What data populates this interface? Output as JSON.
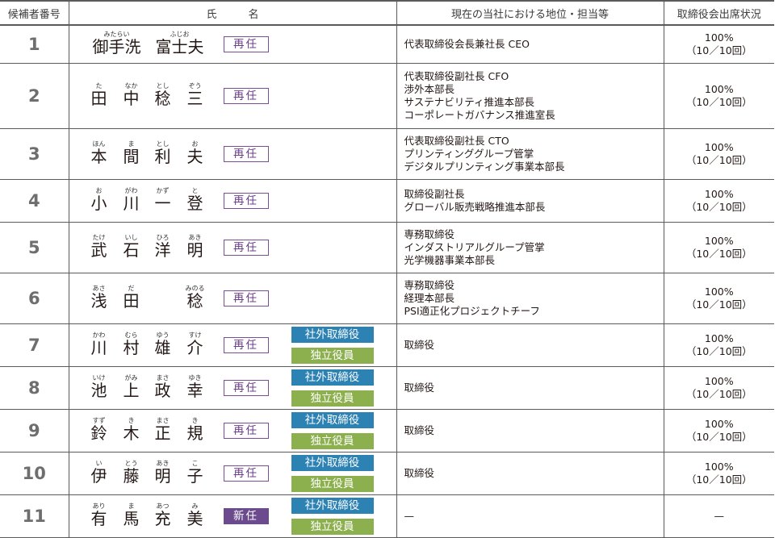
{
  "headers": {
    "number": "候補者番号",
    "name": "氏　　　名",
    "position": "現在の当社における地位・担当等",
    "attendance": "取締役会出席状況"
  },
  "colors": {
    "reappoint": "#6b3f8c",
    "new": "#6b4a8e",
    "outside": "#2d82b4",
    "independent": "#8cb04e"
  },
  "candidates": [
    {
      "no": "1",
      "chars": [
        {
          "k": "御手洗",
          "r": "みたらい"
        },
        {
          "k": "富士夫",
          "r": "ふじお"
        }
      ],
      "status": "再任",
      "outside": "",
      "independent": "",
      "position": [
        "代表取締役会長兼社長 CEO"
      ],
      "attendance": [
        "100%",
        "（10／10回）"
      ]
    },
    {
      "no": "2",
      "chars": [
        {
          "k": "田",
          "r": "た"
        },
        {
          "k": "中",
          "r": "なか"
        },
        {
          "k": "稔",
          "r": "とし"
        },
        {
          "k": "三",
          "r": "ぞう"
        }
      ],
      "status": "再任",
      "outside": "",
      "independent": "",
      "position": [
        "代表取締役副社長 CFO",
        "渉外本部長",
        "サステナビリティ推進本部長",
        "コーポレートガバナンス推進室長"
      ],
      "attendance": [
        "100%",
        "（10／10回）"
      ]
    },
    {
      "no": "3",
      "chars": [
        {
          "k": "本",
          "r": "ほん"
        },
        {
          "k": "間",
          "r": "ま"
        },
        {
          "k": "利",
          "r": "とし"
        },
        {
          "k": "夫",
          "r": "お"
        }
      ],
      "status": "再任",
      "outside": "",
      "independent": "",
      "position": [
        "代表取締役副社長 CTO",
        "プリンティンググループ管掌",
        "デジタルプリンティング事業本部長"
      ],
      "attendance": [
        "100%",
        "（10／10回）"
      ]
    },
    {
      "no": "4",
      "chars": [
        {
          "k": "小",
          "r": "お"
        },
        {
          "k": "川",
          "r": "がわ"
        },
        {
          "k": "一",
          "r": "かず"
        },
        {
          "k": "登",
          "r": "と"
        }
      ],
      "status": "再任",
      "outside": "",
      "independent": "",
      "position": [
        "取締役副社長",
        "グローバル販売戦略推進本部長"
      ],
      "attendance": [
        "100%",
        "（10／10回）"
      ]
    },
    {
      "no": "5",
      "chars": [
        {
          "k": "武",
          "r": "たけ"
        },
        {
          "k": "石",
          "r": "いし"
        },
        {
          "k": "洋",
          "r": "ひろ"
        },
        {
          "k": "明",
          "r": "あき"
        }
      ],
      "status": "再任",
      "outside": "",
      "independent": "",
      "position": [
        "専務取締役",
        "インダストリアルグループ管掌",
        "光学機器事業本部長"
      ],
      "attendance": [
        "100%",
        "（10／10回）"
      ]
    },
    {
      "no": "6",
      "chars": [
        {
          "k": "浅",
          "r": "あさ"
        },
        {
          "k": "田",
          "r": "だ"
        },
        {
          "k": "稔",
          "r": "みのる"
        }
      ],
      "status": "再任",
      "outside": "",
      "independent": "",
      "position": [
        "専務取締役",
        "経理本部長",
        "PSI適正化プロジェクトチーフ"
      ],
      "attendance": [
        "100%",
        "（10／10回）"
      ]
    },
    {
      "no": "7",
      "chars": [
        {
          "k": "川",
          "r": "かわ"
        },
        {
          "k": "村",
          "r": "むら"
        },
        {
          "k": "雄",
          "r": "ゆう"
        },
        {
          "k": "介",
          "r": "すけ"
        }
      ],
      "status": "再任",
      "outside": "社外取締役",
      "independent": "独立役員",
      "position": [
        "取締役"
      ],
      "attendance": [
        "100%",
        "（10／10回）"
      ]
    },
    {
      "no": "8",
      "chars": [
        {
          "k": "池",
          "r": "いけ"
        },
        {
          "k": "上",
          "r": "がみ"
        },
        {
          "k": "政",
          "r": "まさ"
        },
        {
          "k": "幸",
          "r": "ゆき"
        }
      ],
      "status": "再任",
      "outside": "社外取締役",
      "independent": "独立役員",
      "position": [
        "取締役"
      ],
      "attendance": [
        "100%",
        "（10／10回）"
      ]
    },
    {
      "no": "9",
      "chars": [
        {
          "k": "鈴",
          "r": "すず"
        },
        {
          "k": "木",
          "r": "き"
        },
        {
          "k": "正",
          "r": "まさ"
        },
        {
          "k": "規",
          "r": "き"
        }
      ],
      "status": "再任",
      "outside": "社外取締役",
      "independent": "独立役員",
      "position": [
        "取締役"
      ],
      "attendance": [
        "100%",
        "（10／10回）"
      ]
    },
    {
      "no": "10",
      "chars": [
        {
          "k": "伊",
          "r": "い"
        },
        {
          "k": "藤",
          "r": "とう"
        },
        {
          "k": "明",
          "r": "あき"
        },
        {
          "k": "子",
          "r": "こ"
        }
      ],
      "status": "再任",
      "outside": "社外取締役",
      "independent": "独立役員",
      "position": [
        "取締役"
      ],
      "attendance": [
        "100%",
        "（10／10回）"
      ]
    },
    {
      "no": "11",
      "chars": [
        {
          "k": "有",
          "r": "あり"
        },
        {
          "k": "馬",
          "r": "ま"
        },
        {
          "k": "充",
          "r": "あつ"
        },
        {
          "k": "美",
          "r": "み"
        }
      ],
      "status": "新任",
      "outside": "社外取締役",
      "independent": "独立役員",
      "position": [
        "—"
      ],
      "attendance": [
        "—"
      ]
    }
  ]
}
